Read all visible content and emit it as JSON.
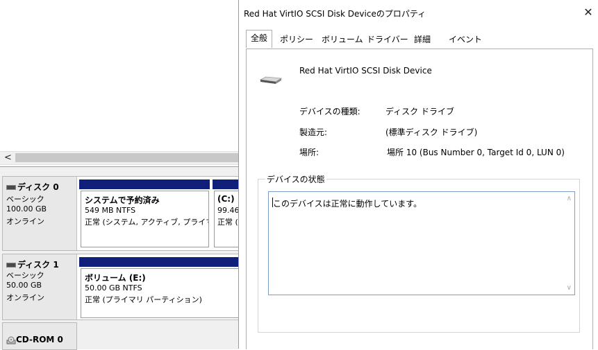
{
  "disk_management": {
    "hscroll_left": "<",
    "disks": [
      {
        "name": "ディスク 0",
        "type": "ベーシック",
        "size": "100.00 GB",
        "state": "オンライン",
        "partitions": [
          {
            "title": "システムで予約済み",
            "size": "549 MB NTFS",
            "status": "正常 (システム, アクティブ, プライマ"
          },
          {
            "title": "(C:)",
            "size": "99.46",
            "status": "正常 ("
          }
        ]
      },
      {
        "name": "ディスク 1",
        "type": "ベーシック",
        "size": "50.00 GB",
        "state": "オンライン",
        "partitions": [
          {
            "title": "ボリューム (E:)",
            "size": "50.00 GB NTFS",
            "status": "正常 (プライマリ パーティション)"
          }
        ]
      }
    ],
    "cdrom": {
      "name": "CD-ROM 0"
    }
  },
  "dialog": {
    "title": "Red Hat VirtIO SCSI Disk Deviceのプロパティ",
    "close_glyph": "✕",
    "tabs": [
      {
        "label": "全般",
        "active": true
      },
      {
        "label": "ポリシー",
        "active": false
      },
      {
        "label": "ボリューム",
        "active": false
      },
      {
        "label": "ドライバー",
        "active": false
      },
      {
        "label": "詳細",
        "active": false
      },
      {
        "label": "イベント",
        "active": false
      }
    ],
    "device_name": "Red Hat VirtIO SCSI Disk Device",
    "device_icon": "disk-drive-icon",
    "properties": {
      "type_label": "デバイスの種類:",
      "type_value": "ディスク ドライブ",
      "manufacturer_label": "製造元:",
      "manufacturer_value": "(標準ディスク ドライブ)",
      "location_label": "場所:",
      "location_value": "場所 10 (Bus Number 0, Target Id 0, LUN 0)"
    },
    "status_group_label": "デバイスの状態",
    "status_text": "このデバイスは正常に動作しています。"
  },
  "colors": {
    "partition_header": "#0f1f7a",
    "status_box_border": "#7a9cc6"
  }
}
